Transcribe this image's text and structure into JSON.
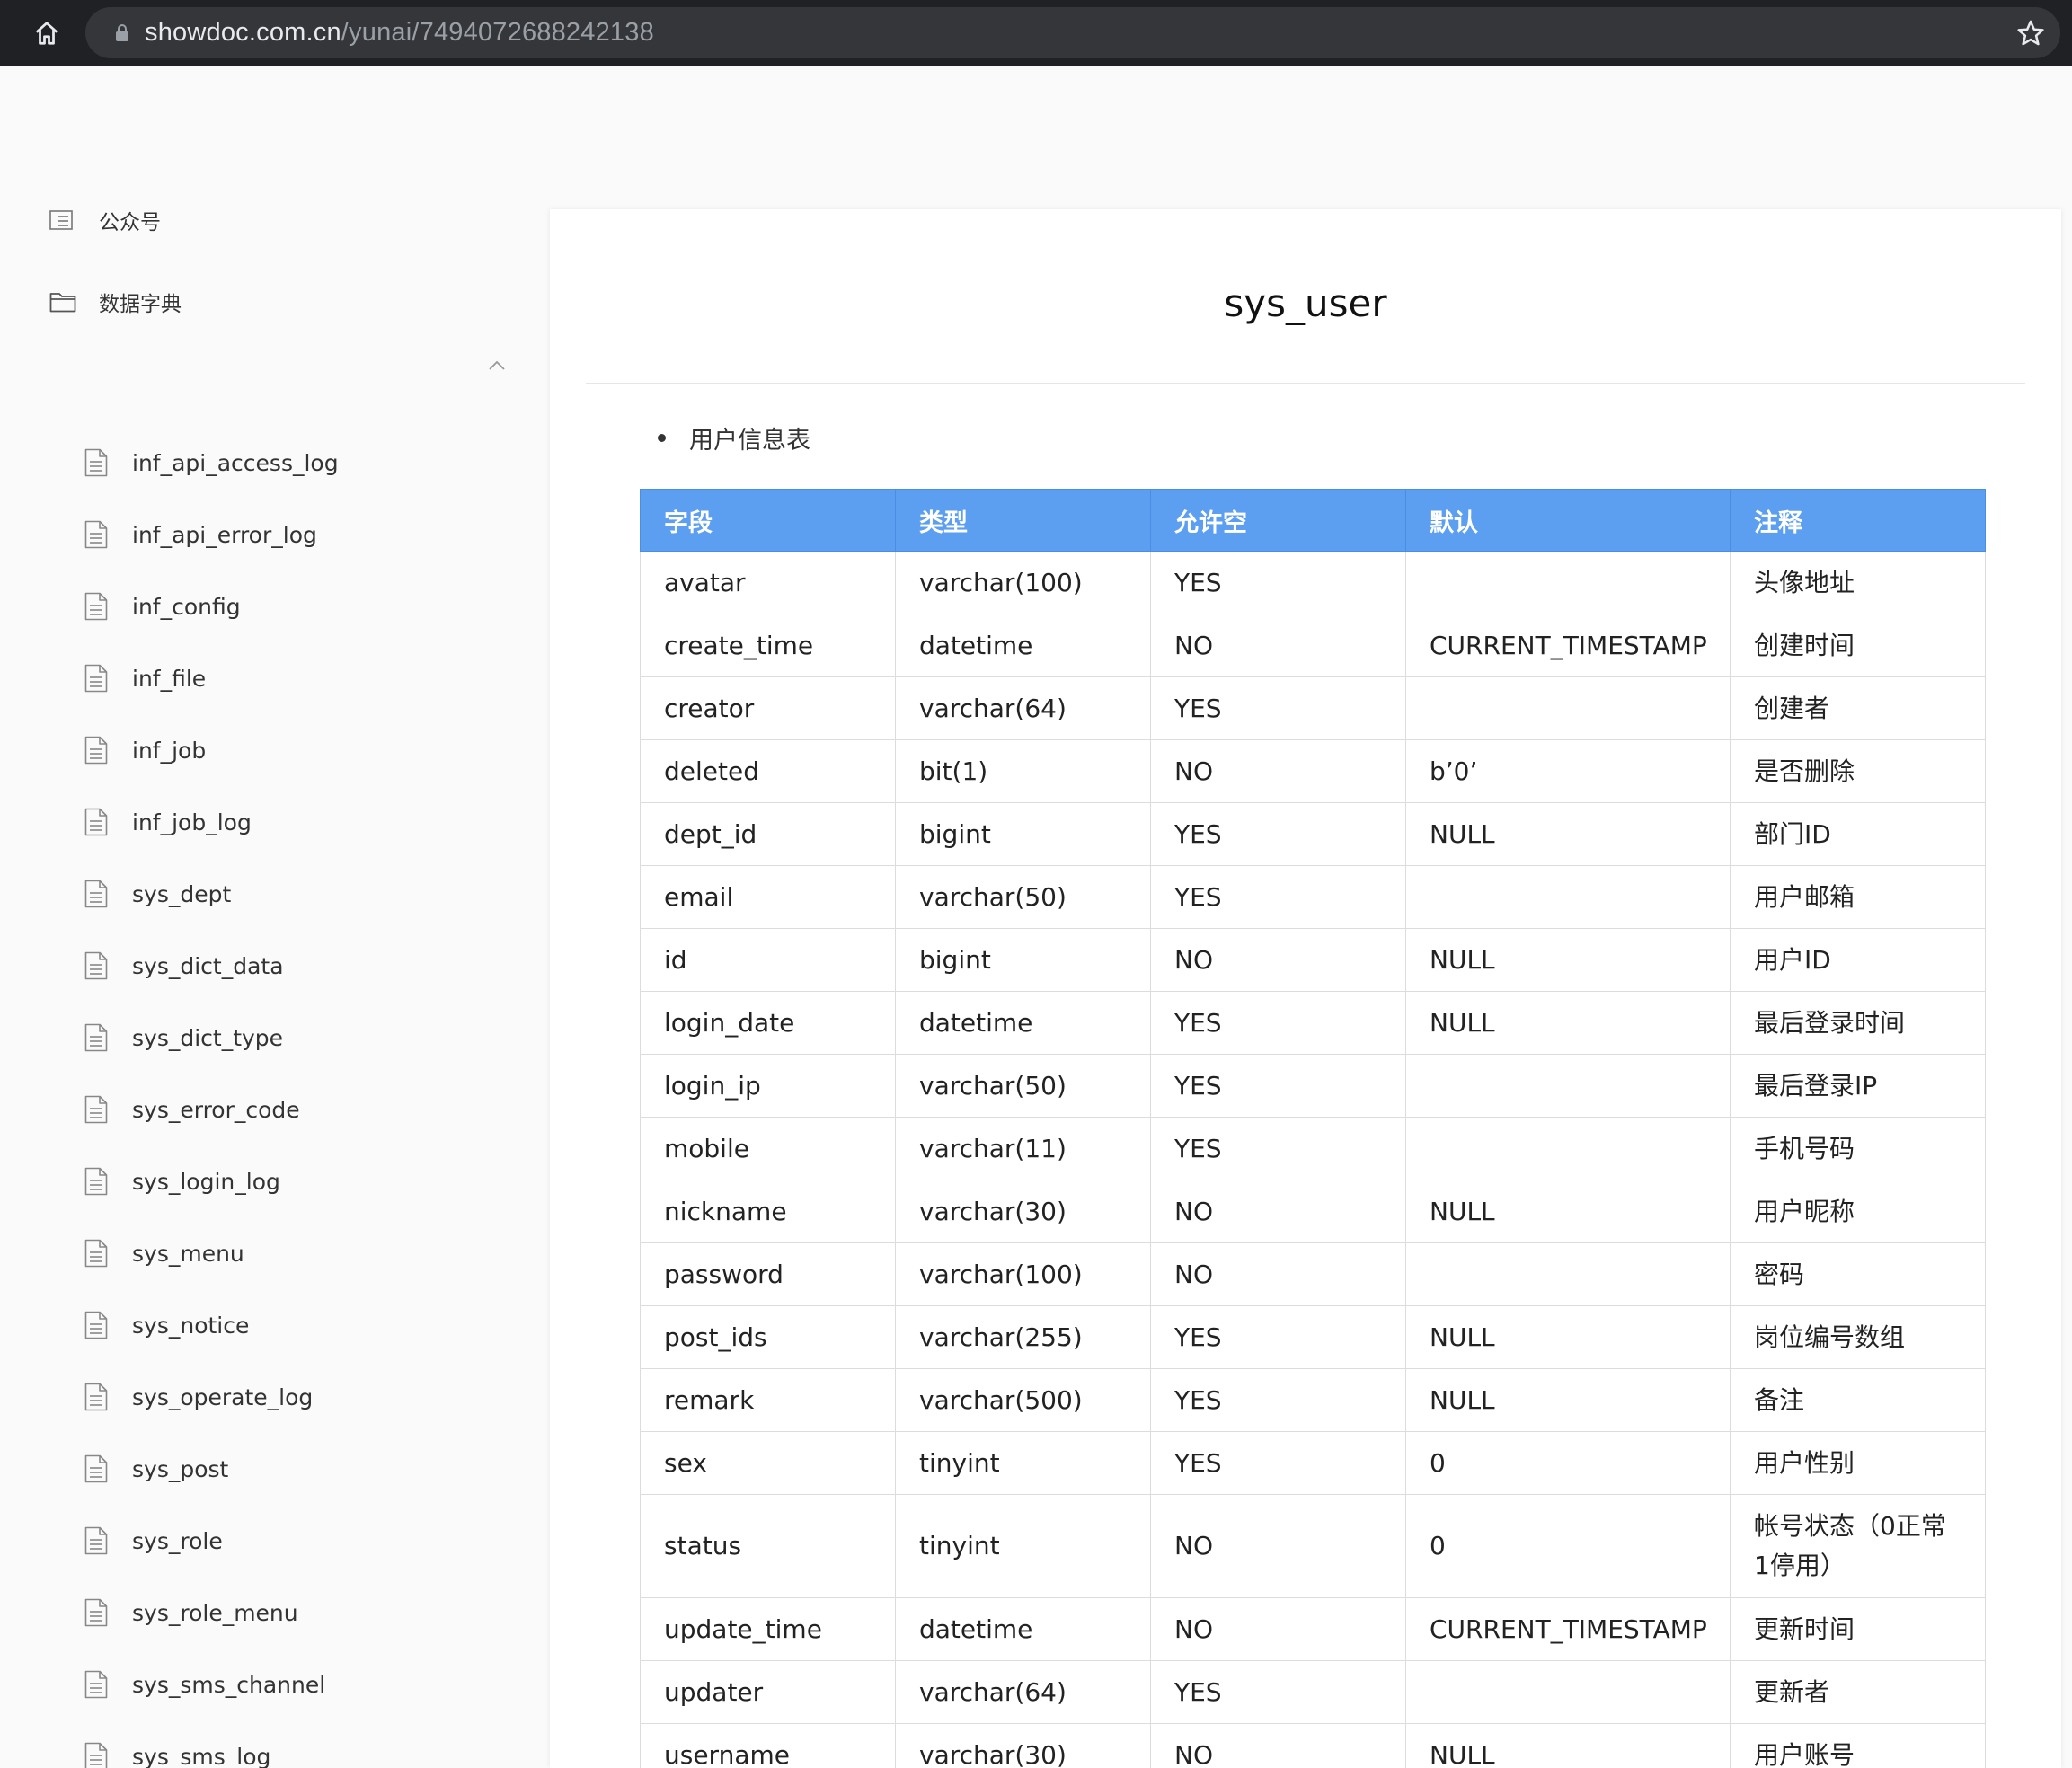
{
  "browser": {
    "url_host": "showdoc.com.cn",
    "url_path": "/yunai/7494072688242138"
  },
  "sidebar": {
    "top_items": [
      {
        "label": "公众号",
        "icon": "list-icon"
      },
      {
        "label": "数据字典",
        "icon": "folder-icon"
      }
    ],
    "items": [
      "inf_api_access_log",
      "inf_api_error_log",
      "inf_config",
      "inf_file",
      "inf_job",
      "inf_job_log",
      "sys_dept",
      "sys_dict_data",
      "sys_dict_type",
      "sys_error_code",
      "sys_login_log",
      "sys_menu",
      "sys_notice",
      "sys_operate_log",
      "sys_post",
      "sys_role",
      "sys_role_menu",
      "sys_sms_channel",
      "sys_sms_log"
    ]
  },
  "main": {
    "title": "sys_user",
    "description": "用户信息表",
    "table": {
      "headers": [
        "字段",
        "类型",
        "允许空",
        "默认",
        "注释"
      ],
      "rows": [
        [
          "avatar",
          "varchar(100)",
          "YES",
          "",
          "头像地址"
        ],
        [
          "create_time",
          "datetime",
          "NO",
          "CURRENT_TIMESTAMP",
          "创建时间"
        ],
        [
          "creator",
          "varchar(64)",
          "YES",
          "",
          "创建者"
        ],
        [
          "deleted",
          "bit(1)",
          "NO",
          "b’0’",
          "是否删除"
        ],
        [
          "dept_id",
          "bigint",
          "YES",
          "NULL",
          "部门ID"
        ],
        [
          "email",
          "varchar(50)",
          "YES",
          "",
          "用户邮箱"
        ],
        [
          "id",
          "bigint",
          "NO",
          "NULL",
          "用户ID"
        ],
        [
          "login_date",
          "datetime",
          "YES",
          "NULL",
          "最后登录时间"
        ],
        [
          "login_ip",
          "varchar(50)",
          "YES",
          "",
          "最后登录IP"
        ],
        [
          "mobile",
          "varchar(11)",
          "YES",
          "",
          "手机号码"
        ],
        [
          "nickname",
          "varchar(30)",
          "NO",
          "NULL",
          "用户昵称"
        ],
        [
          "password",
          "varchar(100)",
          "NO",
          "",
          "密码"
        ],
        [
          "post_ids",
          "varchar(255)",
          "YES",
          "NULL",
          "岗位编号数组"
        ],
        [
          "remark",
          "varchar(500)",
          "YES",
          "NULL",
          "备注"
        ],
        [
          "sex",
          "tinyint",
          "YES",
          "0",
          "用户性别"
        ],
        [
          "status",
          "tinyint",
          "NO",
          "0",
          "帐号状态（0正常 1停用）"
        ],
        [
          "update_time",
          "datetime",
          "NO",
          "CURRENT_TIMESTAMP",
          "更新时间"
        ],
        [
          "updater",
          "varchar(64)",
          "YES",
          "",
          "更新者"
        ],
        [
          "username",
          "varchar(30)",
          "NO",
          "NULL",
          "用户账号"
        ]
      ]
    }
  }
}
